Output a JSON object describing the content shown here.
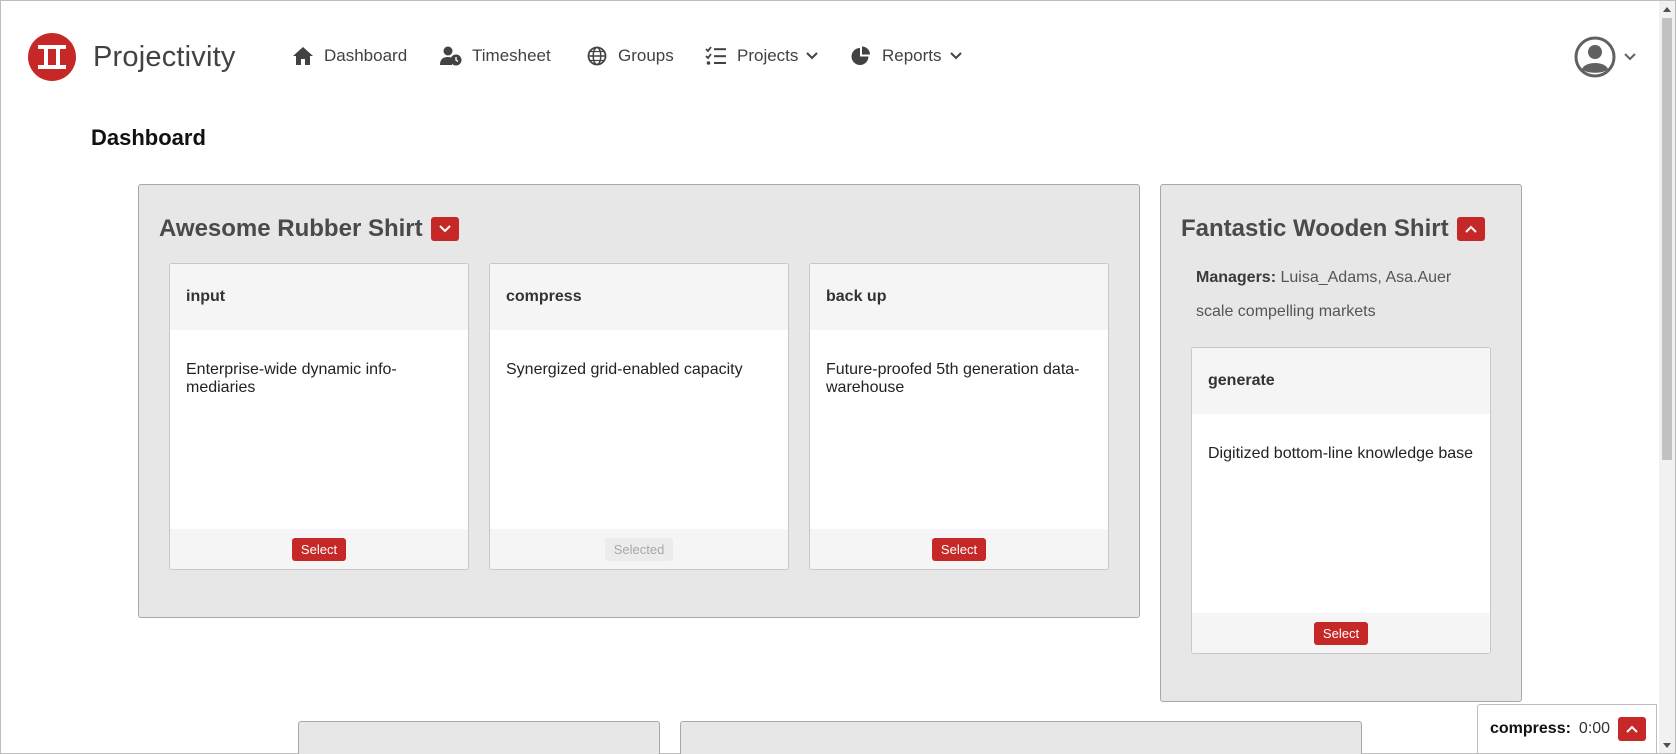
{
  "brand": {
    "name": "Projectivity",
    "color": "#c62828"
  },
  "nav": {
    "dashboard": {
      "label": "Dashboard",
      "icon": "home-icon"
    },
    "timesheet": {
      "label": "Timesheet",
      "icon": "user-clock-icon"
    },
    "groups": {
      "label": "Groups",
      "icon": "globe-icon"
    },
    "projects": {
      "label": "Projects",
      "icon": "tasks-icon"
    },
    "reports": {
      "label": "Reports",
      "icon": "pie-chart-icon"
    }
  },
  "user_menu": {
    "icon": "user-avatar-icon"
  },
  "page": {
    "title": "Dashboard"
  },
  "projects": [
    {
      "title": "Awesome Rubber Shirt",
      "expanded": false,
      "tasks": [
        {
          "name": "input",
          "description": "Enterprise-wide dynamic info-mediaries",
          "button": "Select",
          "selected": false
        },
        {
          "name": "compress",
          "description": "Synergized grid-enabled capacity",
          "button": "Selected",
          "selected": true
        },
        {
          "name": "back up",
          "description": "Future-proofed 5th generation data-warehouse",
          "button": "Select",
          "selected": false
        }
      ]
    },
    {
      "title": "Fantastic Wooden Shirt",
      "expanded": true,
      "managers_label": "Managers:",
      "managers": "Luisa_Adams, Asa.Auer",
      "description": "scale compelling markets",
      "tasks": [
        {
          "name": "generate",
          "description": "Digitized bottom-line knowledge base",
          "button": "Select",
          "selected": false
        }
      ]
    }
  ],
  "timer": {
    "label": "compress:",
    "value": "0:00"
  },
  "colors": {
    "accent": "#c62828",
    "panel_bg": "#e7e7e7",
    "card_header_bg": "#f5f5f5"
  }
}
